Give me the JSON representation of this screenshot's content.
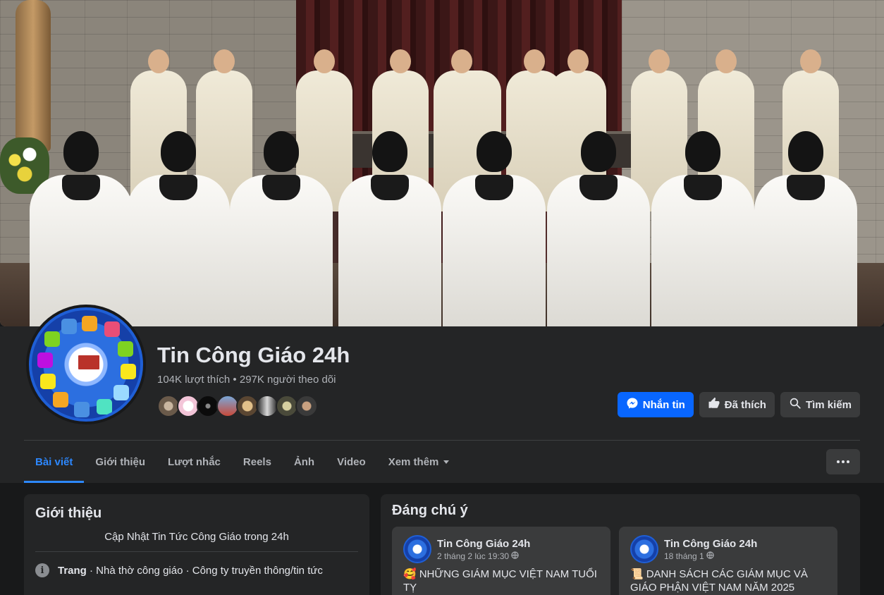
{
  "page": {
    "name": "Tin Công Giáo 24h",
    "stats": "104K lượt thích • 297K người theo dõi"
  },
  "actions": {
    "message": "Nhắn tin",
    "liked": "Đã thích",
    "search": "Tìm kiếm"
  },
  "tabs": [
    {
      "label": "Bài viết",
      "active": true
    },
    {
      "label": "Giới thiệu"
    },
    {
      "label": "Lượt nhắc"
    },
    {
      "label": "Reels"
    },
    {
      "label": "Ảnh"
    },
    {
      "label": "Video"
    },
    {
      "label": "Xem thêm"
    }
  ],
  "intro": {
    "title": "Giới thiệu",
    "bio": "Cập Nhật Tin Tức Công Giáo trong 24h",
    "category_label": "Trang",
    "category_text": " · Nhà thờ công giáo · Công ty truyền thông/tin tức"
  },
  "featured": {
    "title": "Đáng chú ý",
    "posts": [
      {
        "author": "Tin Công Giáo 24h",
        "time": "2 tháng 2 lúc 19:30",
        "emoji": "🥰",
        "text": "NHỮNG GIÁM MỤC VIỆT NAM TUỔI TỴ"
      },
      {
        "author": "Tin Công Giáo 24h",
        "time": "18 tháng 1",
        "emoji": "📜",
        "text": "DANH SÁCH CÁC GIÁM MỤC VÀ GIÁO PHẬN VIỆT NAM NĂM 2025"
      }
    ]
  },
  "colors": {
    "accent": "#0866ff",
    "tab_active": "#2d88ff",
    "surface": "#242526",
    "background": "#18191a"
  },
  "icons": [
    "messenger-icon",
    "thumbs-up-icon",
    "search-icon",
    "more-dots-icon",
    "info-icon",
    "globe-icon",
    "caret-down-icon"
  ]
}
